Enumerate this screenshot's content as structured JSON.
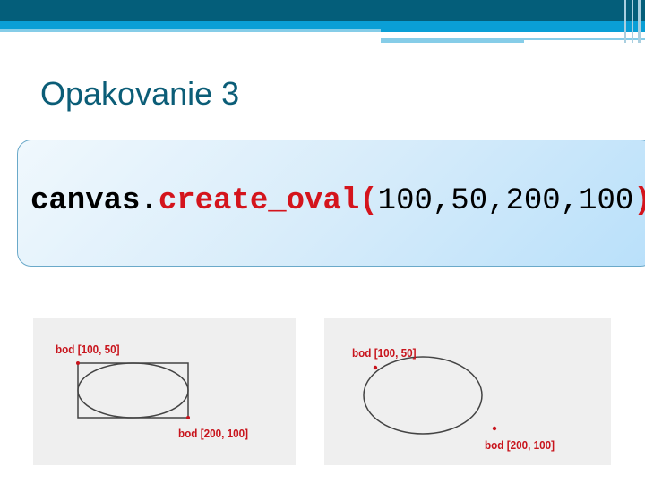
{
  "slide": {
    "title": "Opakovanie 3"
  },
  "code": {
    "object": "canvas.",
    "method": "create_oval",
    "open": "(",
    "args": "100,50,200,100",
    "close": ")"
  },
  "figures": [
    {
      "label_start": "bod [100, 50]",
      "label_end": "bod [200, 100]",
      "shows_bounding_box": true
    },
    {
      "label_start": "bod [100, 50]",
      "label_end": "bod [200, 100]",
      "shows_bounding_box": false
    }
  ],
  "colors": {
    "header": "#045e7a",
    "accent": "#0a9fd6",
    "title": "#0b5d77",
    "keyword": "#d4141c"
  }
}
